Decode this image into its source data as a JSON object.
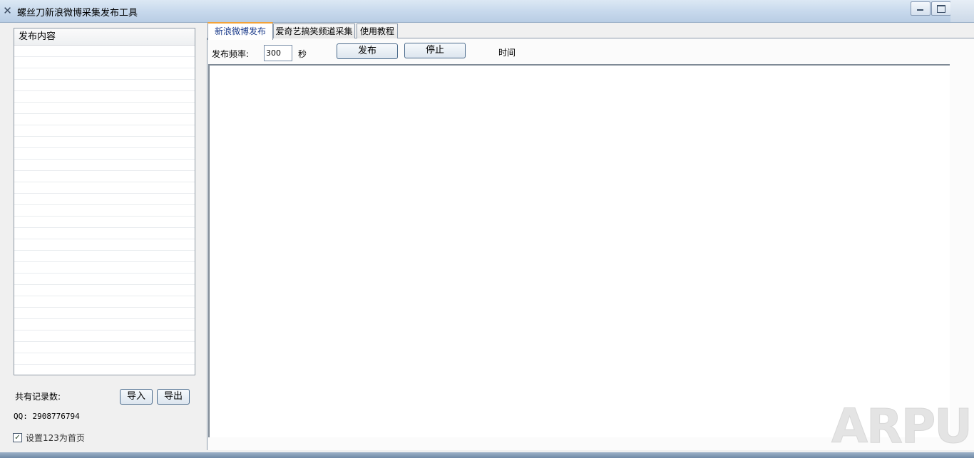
{
  "window": {
    "title": "螺丝刀新浪微博采集发布工具"
  },
  "left_panel": {
    "list_header": "发布内容",
    "record_count_label": "共有记录数:",
    "import_button": "导入",
    "export_button": "导出",
    "qq_text": "QQ: 2908776794",
    "homepage_checkbox": {
      "label": "设置123为首页",
      "checked": true
    }
  },
  "tabs": [
    {
      "label": "新浪微博发布",
      "active": true
    },
    {
      "label": "爱奇艺搞笑频道采集",
      "active": false
    },
    {
      "label": "使用教程",
      "active": false
    }
  ],
  "publish_tab": {
    "frequency_label": "发布频率:",
    "frequency_value": "300",
    "seconds_label": "秒",
    "publish_button": "发布",
    "stop_button": "停止",
    "time_label": "时间"
  },
  "watermark": "ARPUN",
  "colors": {
    "active_tab_accent": "#f2a238",
    "active_tab_text": "#1a3a8a",
    "titlebar": "#c6d8ec"
  }
}
